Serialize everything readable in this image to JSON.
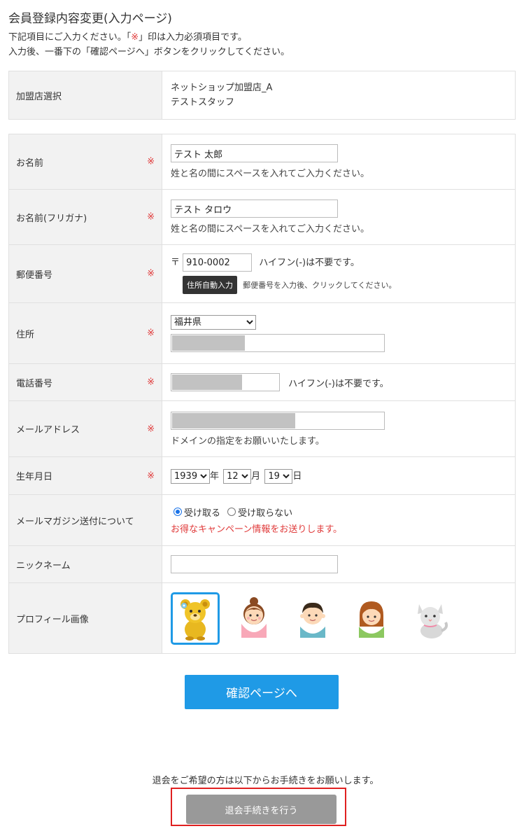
{
  "page_title": "会員登録内容変更(入力ページ)",
  "intro": {
    "line1_before": "下記項目にご入力ください。「",
    "line1_mark": "※",
    "line1_after": "」印は入力必須項目です。",
    "line2": "入力後、一番下の「確認ページへ」ボタンをクリックしてください。"
  },
  "required_mark": "※",
  "shop": {
    "label": "加盟店選択",
    "name": "ネットショップ加盟店_A",
    "staff": "テストスタッフ"
  },
  "fields": {
    "name": {
      "label": "お名前",
      "value": "テスト 太郎",
      "hint": "姓と名の間にスペースを入れてご入力ください。"
    },
    "kana": {
      "label": "お名前(フリガナ)",
      "value": "テスト タロウ",
      "hint": "姓と名の間にスペースを入れてご入力ください。"
    },
    "zip": {
      "label": "郵便番号",
      "prefix": "〒",
      "value": "910-0002",
      "note": "ハイフン(-)は不要です。",
      "auto_button": "住所自動入力",
      "auto_hint": "郵便番号を入力後、クリックしてください。"
    },
    "address": {
      "label": "住所",
      "prefecture": "福井県"
    },
    "phone": {
      "label": "電話番号",
      "note": "ハイフン(-)は不要です。"
    },
    "email": {
      "label": "メールアドレス",
      "hint": "ドメインの指定をお願いいたします。"
    },
    "birthday": {
      "label": "生年月日",
      "year": "1939",
      "year_unit": "年",
      "month": "12",
      "month_unit": "月",
      "day": "19",
      "day_unit": "日"
    },
    "newsletter": {
      "label": "メールマガジン送付について",
      "option_yes": "受け取る",
      "option_no": "受け取らない",
      "selected": "受け取る",
      "promo": "お得なキャンペーン情報をお送りします。"
    },
    "nickname": {
      "label": "ニックネーム",
      "value": ""
    },
    "profile_image": {
      "label": "プロフィール画像",
      "avatars": [
        "bear-avatar",
        "girl-avatar",
        "boy-avatar",
        "woman-avatar",
        "cat-avatar"
      ],
      "selected": "bear-avatar"
    }
  },
  "confirm_button": "確認ページへ",
  "withdraw": {
    "note": "退会をご希望の方は以下からお手続きをお願いします。",
    "button": "退会手続きを行う"
  },
  "colors": {
    "accent": "#1f9ae6",
    "required": "#e03a3a",
    "withdraw_frame": "#e02020",
    "withdraw_button": "#999999"
  }
}
